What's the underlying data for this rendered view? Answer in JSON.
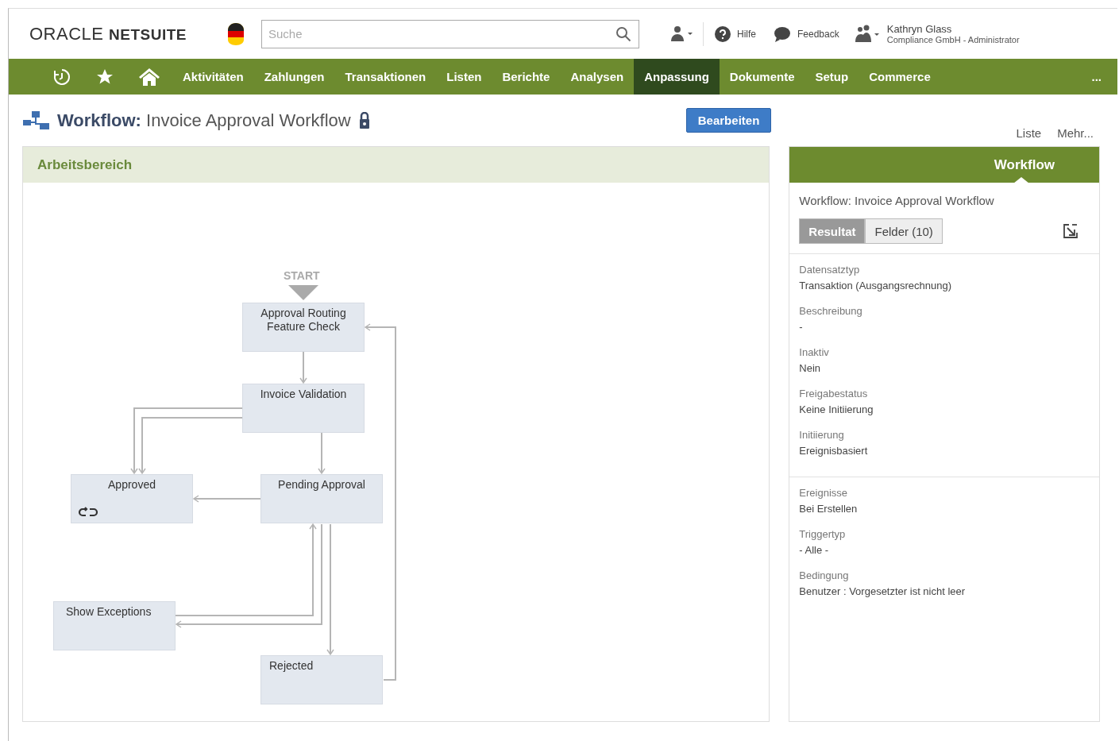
{
  "header": {
    "logo": "ORACLE **NETSUITE**",
    "search": {
      "placeholder": "Suche"
    },
    "help": "Hilfe",
    "feedback": "Feedback",
    "user": {
      "name": "Kathryn Glass",
      "role": "Compliance GmbH - Administrator"
    }
  },
  "nav": [
    {
      "kind": "icon",
      "selected": false
    },
    {
      "kind": "icon",
      "selected": false
    },
    {
      "kind": "icon",
      "selected": false
    },
    {
      "kind": "text",
      "label": "Aktivitäten",
      "selected": false
    },
    {
      "kind": "text",
      "label": "Zahlungen",
      "selected": false
    },
    {
      "kind": "text",
      "label": "Transaktionen",
      "selected": false
    },
    {
      "kind": "text",
      "label": "Listen",
      "selected": false
    },
    {
      "kind": "text",
      "label": "Berichte",
      "selected": false
    },
    {
      "kind": "text",
      "label": "Analysen",
      "selected": false
    },
    {
      "kind": "text",
      "label": "Anpassung",
      "selected": true
    },
    {
      "kind": "text",
      "label": "Dokumente",
      "selected": false
    },
    {
      "kind": "text",
      "label": "Setup",
      "selected": false
    },
    {
      "kind": "text",
      "label": "Commerce",
      "selected": false
    },
    {
      "kind": "more",
      "label": "...",
      "selected": false
    }
  ],
  "page": {
    "type_label": "Workflow:",
    "name": "Invoice Approval Workflow",
    "locked": true,
    "edit_button": "Bearbeiten",
    "links": [
      "Liste",
      "Mehr..."
    ]
  },
  "workspace": {
    "title": "Arbeitsbereich",
    "start": "START",
    "states": [
      {
        "label": "Approval Routing Feature Check",
        "repeat": false
      },
      {
        "label": "Invoice Validation",
        "repeat": false
      },
      {
        "label": "Approved",
        "repeat": true
      },
      {
        "label": "Pending Approval",
        "repeat": false
      },
      {
        "label": "Show Exceptions",
        "repeat": false
      },
      {
        "label": "Rejected",
        "repeat": false
      }
    ]
  },
  "side_panel": {
    "tab": "Workflow",
    "title": "Workflow: Invoice Approval Workflow",
    "toggle": [
      {
        "label": "Resultat",
        "selected": true
      },
      {
        "label": "Felder (10)",
        "selected": false
      }
    ],
    "sections": [
      [
        {
          "label": "Datensatztyp",
          "value": "Transaktion (Ausgangsrechnung)"
        },
        {
          "label": "Beschreibung",
          "value": "-"
        },
        {
          "label": "Inaktiv",
          "value": "Nein"
        },
        {
          "label": "Freigabestatus",
          "value": "Keine Initiierung"
        },
        {
          "label": "Initiierung",
          "value": "Ereignisbasiert"
        }
      ],
      [
        {
          "label": "Ereignisse",
          "value": "Bei Erstellen"
        },
        {
          "label": "Triggertyp",
          "value": "- Alle -"
        },
        {
          "label": "Bedingung",
          "value": "Benutzer : Vorgesetzter ist nicht leer"
        }
      ]
    ]
  }
}
